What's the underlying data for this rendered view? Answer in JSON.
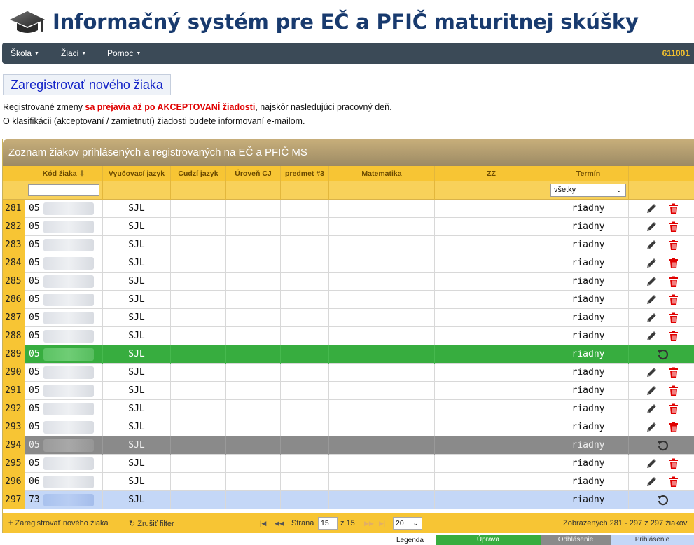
{
  "app": {
    "title": "Informačný systém pre EČ a PFIČ maturitnej skúšky"
  },
  "nav": {
    "items": [
      {
        "label": "Škola"
      },
      {
        "label": "Žiaci"
      },
      {
        "label": "Pomoc"
      }
    ],
    "school_code": "611001"
  },
  "register_button": "Zaregistrovať nového žiaka",
  "notice": {
    "line1_before": "Registrované zmeny ",
    "line1_emphasis": "sa prejavia až po AKCEPTOVANÍ žiadosti",
    "line1_after": ", najskôr nasledujúci pracovný deň.",
    "line2": "O klasifikácii (akceptovaní / zamietnutí) žiadosti budete informovaní e-mailom."
  },
  "grid": {
    "caption": "Zoznam žiakov prihlásených a registrovaných na EČ a PFIČ MS",
    "columns": [
      {
        "label": ""
      },
      {
        "label": "Kód žiaka",
        "sort_icon": "sort-icon"
      },
      {
        "label": "Vyučovací jazyk"
      },
      {
        "label": "Cudzí jazyk"
      },
      {
        "label": "Úroveň CJ"
      },
      {
        "label": "predmet #3"
      },
      {
        "label": "Matematika"
      },
      {
        "label": "ZZ"
      },
      {
        "label": "Termín"
      },
      {
        "label": ""
      }
    ],
    "term_filter": {
      "selected": "všetky",
      "icon": "chevron-down-icon"
    },
    "rows": [
      {
        "num": "281",
        "code": "05",
        "lang": "SJL",
        "term": "riadny",
        "state": "normal"
      },
      {
        "num": "282",
        "code": "05",
        "lang": "SJL",
        "term": "riadny",
        "state": "normal"
      },
      {
        "num": "283",
        "code": "05",
        "lang": "SJL",
        "term": "riadny",
        "state": "normal"
      },
      {
        "num": "284",
        "code": "05",
        "lang": "SJL",
        "term": "riadny",
        "state": "normal"
      },
      {
        "num": "285",
        "code": "05",
        "lang": "SJL",
        "term": "riadny",
        "state": "normal"
      },
      {
        "num": "286",
        "code": "05",
        "lang": "SJL",
        "term": "riadny",
        "state": "normal"
      },
      {
        "num": "287",
        "code": "05",
        "lang": "SJL",
        "term": "riadny",
        "state": "normal"
      },
      {
        "num": "288",
        "code": "05",
        "lang": "SJL",
        "term": "riadny",
        "state": "normal"
      },
      {
        "num": "289",
        "code": "05",
        "lang": "SJL",
        "term": "riadny",
        "state": "edit"
      },
      {
        "num": "290",
        "code": "05",
        "lang": "SJL",
        "term": "riadny",
        "state": "normal"
      },
      {
        "num": "291",
        "code": "05",
        "lang": "SJL",
        "term": "riadny",
        "state": "normal"
      },
      {
        "num": "292",
        "code": "05",
        "lang": "SJL",
        "term": "riadny",
        "state": "normal"
      },
      {
        "num": "293",
        "code": "05",
        "lang": "SJL",
        "term": "riadny",
        "state": "normal"
      },
      {
        "num": "294",
        "code": "05",
        "lang": "SJL",
        "term": "riadny",
        "state": "unregistered"
      },
      {
        "num": "295",
        "code": "05",
        "lang": "SJL",
        "term": "riadny",
        "state": "normal"
      },
      {
        "num": "296",
        "code": "06",
        "lang": "SJL",
        "term": "riadny",
        "state": "normal"
      },
      {
        "num": "297",
        "code": "73",
        "lang": "SJL",
        "term": "riadny",
        "state": "registered"
      }
    ],
    "pager": {
      "add_label": "Zaregistrovať nového žiaka",
      "clear_label": "Zrušiť filter",
      "page_label": "Strana",
      "page_value": "15",
      "of_label": "z 15",
      "page_size": "20",
      "summary": "Zobrazených 281 - 297 z 297 žiakov"
    }
  },
  "legend": {
    "label": "Legenda",
    "edit": "Úprava",
    "unregister": "Odhlásenie",
    "register": "Prihlásenie"
  },
  "colors": {
    "header_gold": "#f7c534",
    "edit_green": "#37ad3f",
    "unregister_gray": "#8a8a8a",
    "register_blue": "#c4d7f7",
    "delete_red": "#e00000",
    "nav_dark": "#3b4a57",
    "title_blue": "#183a6e"
  }
}
